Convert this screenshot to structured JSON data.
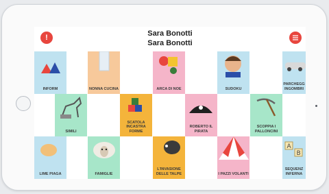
{
  "header": {
    "title_line1": "Sara Bonotti",
    "title_line2": "Sara Bonotti"
  },
  "buttons": {
    "info_glyph": "!",
    "menu_icon": "hamburger-menu-icon"
  },
  "colors": {
    "accent": "#e8463e",
    "tile_peach": "#f7c99b",
    "tile_green": "#a7e6c9",
    "tile_pink": "#f5b5c9",
    "tile_blue": "#bfe2f0",
    "tile_orange": "#f4b43b"
  },
  "tiles": {
    "informa": "INFORM",
    "nonna_cucina": "NONNA CUCINA",
    "arca_di_noe": "ARCA DI NOE",
    "sudoku": "SUDOKU",
    "parcheggio": "PARCHEGG INGOMBRI",
    "simili": "SIMILI",
    "scatola": "SCATOLA INCASTRA FORME",
    "roberto": "ROBERTO IL PIRATA",
    "scoppia": "SCOPPIA I PALLONCINI",
    "lime_row3": "LIME PIAGA",
    "famiglie": "FAMIGLIE",
    "invasione": "L'INVASIONE DELLE TALPE",
    "pazzi_volanti": "I PAZZI VOLANTI",
    "sequenze": "SEQUENZ INFERNA"
  }
}
